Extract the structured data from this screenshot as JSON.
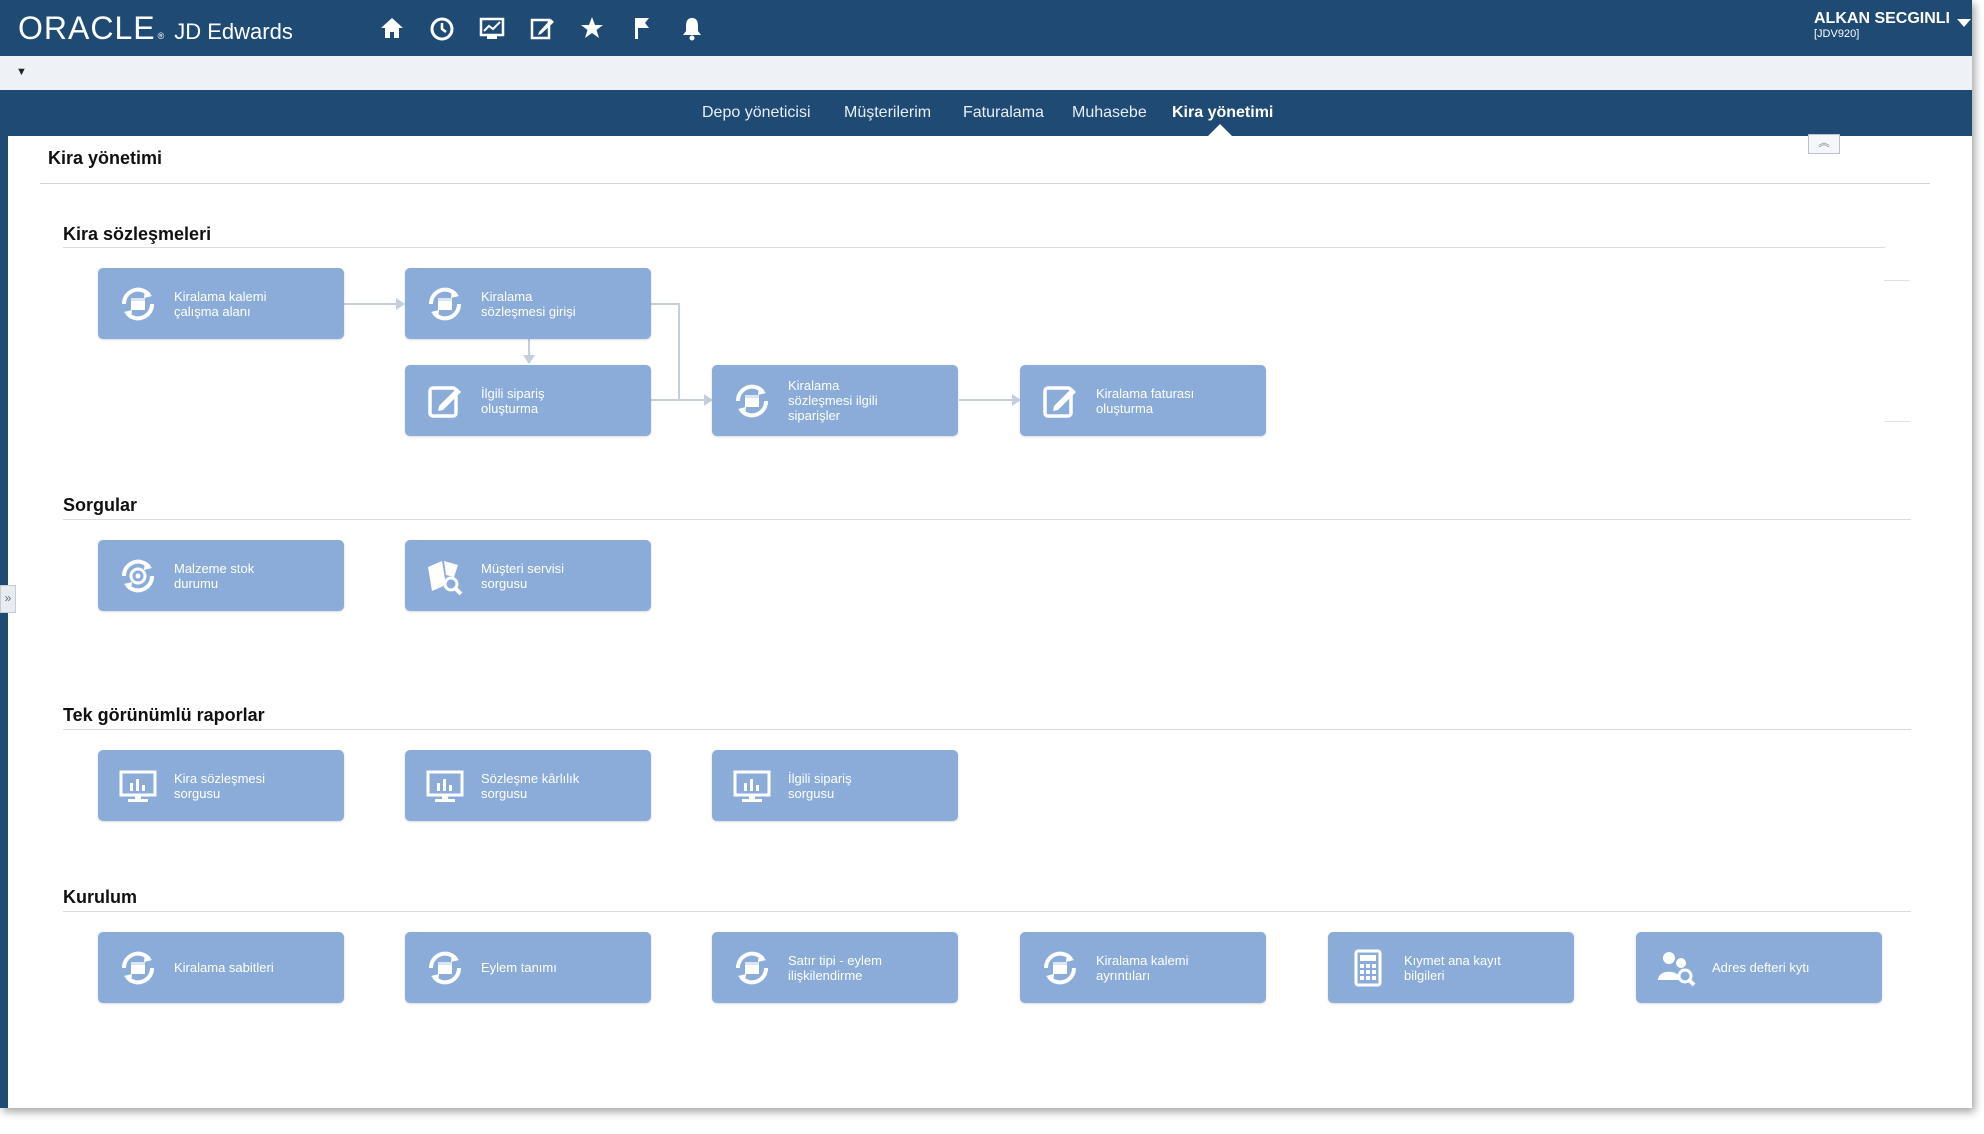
{
  "header": {
    "brand": "ORACLE",
    "product": "JD Edwards",
    "icons": [
      "home-icon",
      "recent-icon",
      "chart-icon",
      "edit-icon",
      "favorite-star-icon",
      "flag-icon",
      "bell-icon"
    ],
    "user_name": "ALKAN SECGINLI",
    "user_env": "[JDV920]"
  },
  "tabs": [
    {
      "label": "Depo yöneticisi"
    },
    {
      "label": "Müşterilerim"
    },
    {
      "label": "Faturalama"
    },
    {
      "label": "Muhasebe"
    },
    {
      "label": "Kira yönetimi",
      "active": true
    }
  ],
  "page": {
    "title": "Kira yönetimi"
  },
  "sections": {
    "contracts": {
      "title": "Kira sözleşmeleri",
      "tiles": [
        {
          "label": "Kiralama kalemi\nçalışma alanı",
          "icon": "refresh-calendar-icon"
        },
        {
          "label": "Kiralama\nsözleşmesi girişi",
          "icon": "refresh-calendar-icon"
        },
        {
          "label": "İlgili sipariş\noluşturma",
          "icon": "edit-form-icon"
        },
        {
          "label": "Kiralama\nsözleşmesi ilgili\nsiparişler",
          "icon": "refresh-calendar-icon"
        },
        {
          "label": "Kiralama faturası\noluşturma",
          "icon": "edit-form-icon"
        }
      ]
    },
    "queries": {
      "title": "Sorgular",
      "tiles": [
        {
          "label": "Malzeme stok\ndurumu",
          "icon": "stock-target-icon"
        },
        {
          "label": "Müşteri servisi\nsorgusu",
          "icon": "service-search-icon"
        }
      ]
    },
    "reports": {
      "title": "Tek görünümlü raporlar",
      "tiles": [
        {
          "label": "Kira sözleşmesi\nsorgusu",
          "icon": "monitor-chart-icon"
        },
        {
          "label": "Sözleşme kârlılık\nsorgusu",
          "icon": "monitor-chart-icon"
        },
        {
          "label": "İlgili sipariş\nsorgusu",
          "icon": "monitor-chart-icon"
        }
      ]
    },
    "setup": {
      "title": "Kurulum",
      "tiles": [
        {
          "label": "Kiralama sabitleri",
          "icon": "refresh-calendar-icon"
        },
        {
          "label": "Eylem tanımı",
          "icon": "refresh-calendar-icon"
        },
        {
          "label": "Satır tipi - eylem\nilişkilendirme",
          "icon": "refresh-calendar-icon"
        },
        {
          "label": "Kiralama kalemi\nayrıntıları",
          "icon": "refresh-calendar-icon"
        },
        {
          "label": "Kıymet ana kayıt\nbilgileri",
          "icon": "calculator-icon"
        },
        {
          "label": "Adres defteri kytı",
          "icon": "people-search-icon"
        }
      ]
    }
  },
  "colors": {
    "header_bg": "#1f4a74",
    "tile_bg": "#8bacd8",
    "connector": "#c4cfdc"
  }
}
